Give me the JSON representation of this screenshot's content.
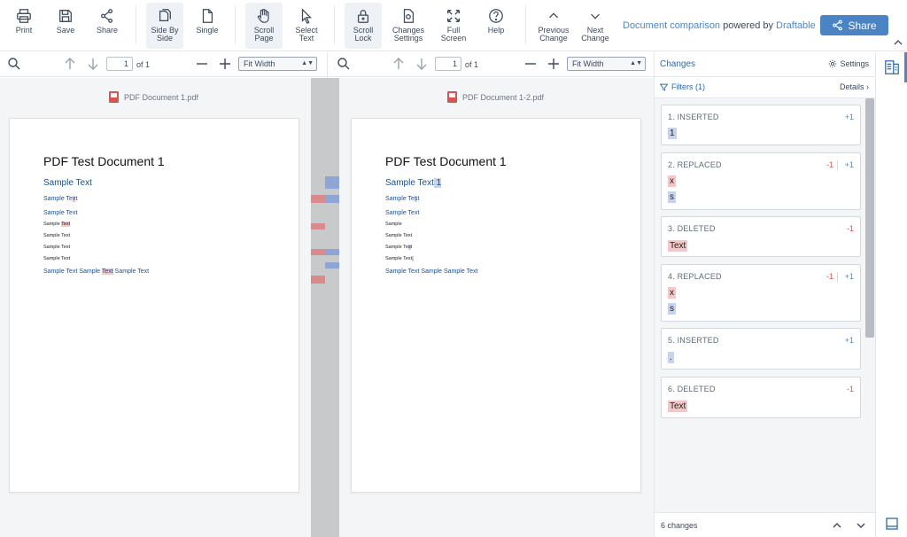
{
  "toolbar": {
    "print": "Print",
    "save": "Save",
    "share": "Share",
    "side_by_side": "Side By\nSide",
    "single": "Single",
    "scroll_page": "Scroll\nPage",
    "select_text": "Select\nText",
    "scroll_lock": "Scroll\nLock",
    "changes_settings": "Changes\nSettings",
    "full_screen": "Full\nScreen",
    "help": "Help",
    "previous_change": "Previous\nChange",
    "next_change": "Next\nChange",
    "powered_prefix": "Document comparison",
    "powered_mid": " powered by ",
    "powered_brand": "Draftable",
    "share_button": "Share"
  },
  "left_viewer": {
    "page_value": "1",
    "of_pages": "of 1",
    "zoom": "Fit Width",
    "filename": "PDF Document 1.pdf",
    "doc_title": "PDF Test Document 1",
    "subtitle": "Sample Text",
    "line1_a": "Sample Te",
    "line1_b": "x",
    "line1_c": "t",
    "line2": "Sample Text",
    "line3_a": "Sample ",
    "line3_b": "Text",
    "line4": "Sample Text",
    "line5": "Sample Text",
    "line6": "Sample Text",
    "line7_a": "Sample Text Sample ",
    "line7_b": "Text",
    "line7_c": " Sample Text"
  },
  "right_viewer": {
    "page_value": "1",
    "of_pages": "of 1",
    "zoom": "Fit Width",
    "filename": "PDF Document 1-2.pdf",
    "doc_title": "PDF Test Document 1",
    "subtitle_a": "Sample Text",
    "subtitle_b": " 1",
    "line1_a": "Sample Te",
    "line1_b": "s",
    "line1_c": "t",
    "line2": "Sample Text",
    "line3": "Sample",
    "line4": "Sample Text",
    "line5_a": "Sample Te",
    "line5_b": "s",
    "line5_c": "t",
    "line6_a": "Sample Text",
    "line6_b": ".",
    "line7": "Sample Text Sample Sample Text"
  },
  "changes": {
    "title": "Changes",
    "settings": "Settings",
    "filters": "Filters (1)",
    "details": "Details",
    "items": [
      {
        "title": "1. INSERTED",
        "neg": "",
        "pos": "+1",
        "del": "",
        "ins": "1"
      },
      {
        "title": "2. REPLACED",
        "neg": "-1",
        "pos": "+1",
        "del": "x",
        "ins": "s"
      },
      {
        "title": "3. DELETED",
        "neg": "-1",
        "pos": "",
        "del": "Text",
        "ins": ""
      },
      {
        "title": "4. REPLACED",
        "neg": "-1",
        "pos": "+1",
        "del": "x",
        "ins": "s"
      },
      {
        "title": "5. INSERTED",
        "neg": "",
        "pos": "+1",
        "del": "",
        "ins": "."
      },
      {
        "title": "6. DELETED",
        "neg": "-1",
        "pos": "",
        "del": "Text",
        "ins": ""
      }
    ],
    "footer_count": "6 changes"
  },
  "colors": {
    "accent": "#4b84c4",
    "deleted": "#f3c6c8",
    "inserted": "#c6d3ea",
    "deleted_text": "#d9534f",
    "inserted_text": "#4a88c8"
  }
}
